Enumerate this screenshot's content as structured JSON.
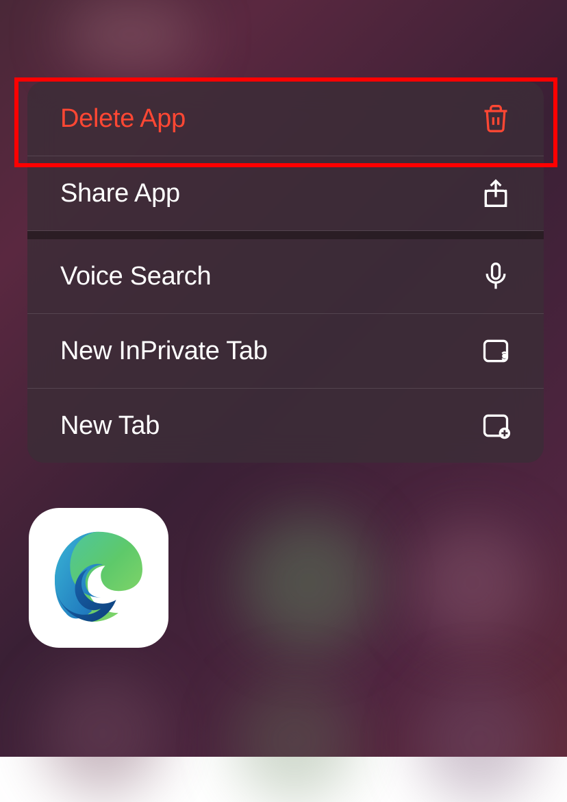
{
  "menu": {
    "items": [
      {
        "label": "Delete App",
        "icon": "trash-icon",
        "destructive": true
      },
      {
        "label": "Share App",
        "icon": "share-icon",
        "destructive": false
      },
      {
        "label": "Voice Search",
        "icon": "microphone-icon",
        "destructive": false
      },
      {
        "label": "New InPrivate Tab",
        "icon": "private-tab-icon",
        "destructive": false
      },
      {
        "label": "New Tab",
        "icon": "new-tab-icon",
        "destructive": false
      }
    ]
  },
  "app": {
    "name": "Microsoft Edge"
  },
  "highlight": {
    "target": "Delete App",
    "color": "#ff0000"
  }
}
